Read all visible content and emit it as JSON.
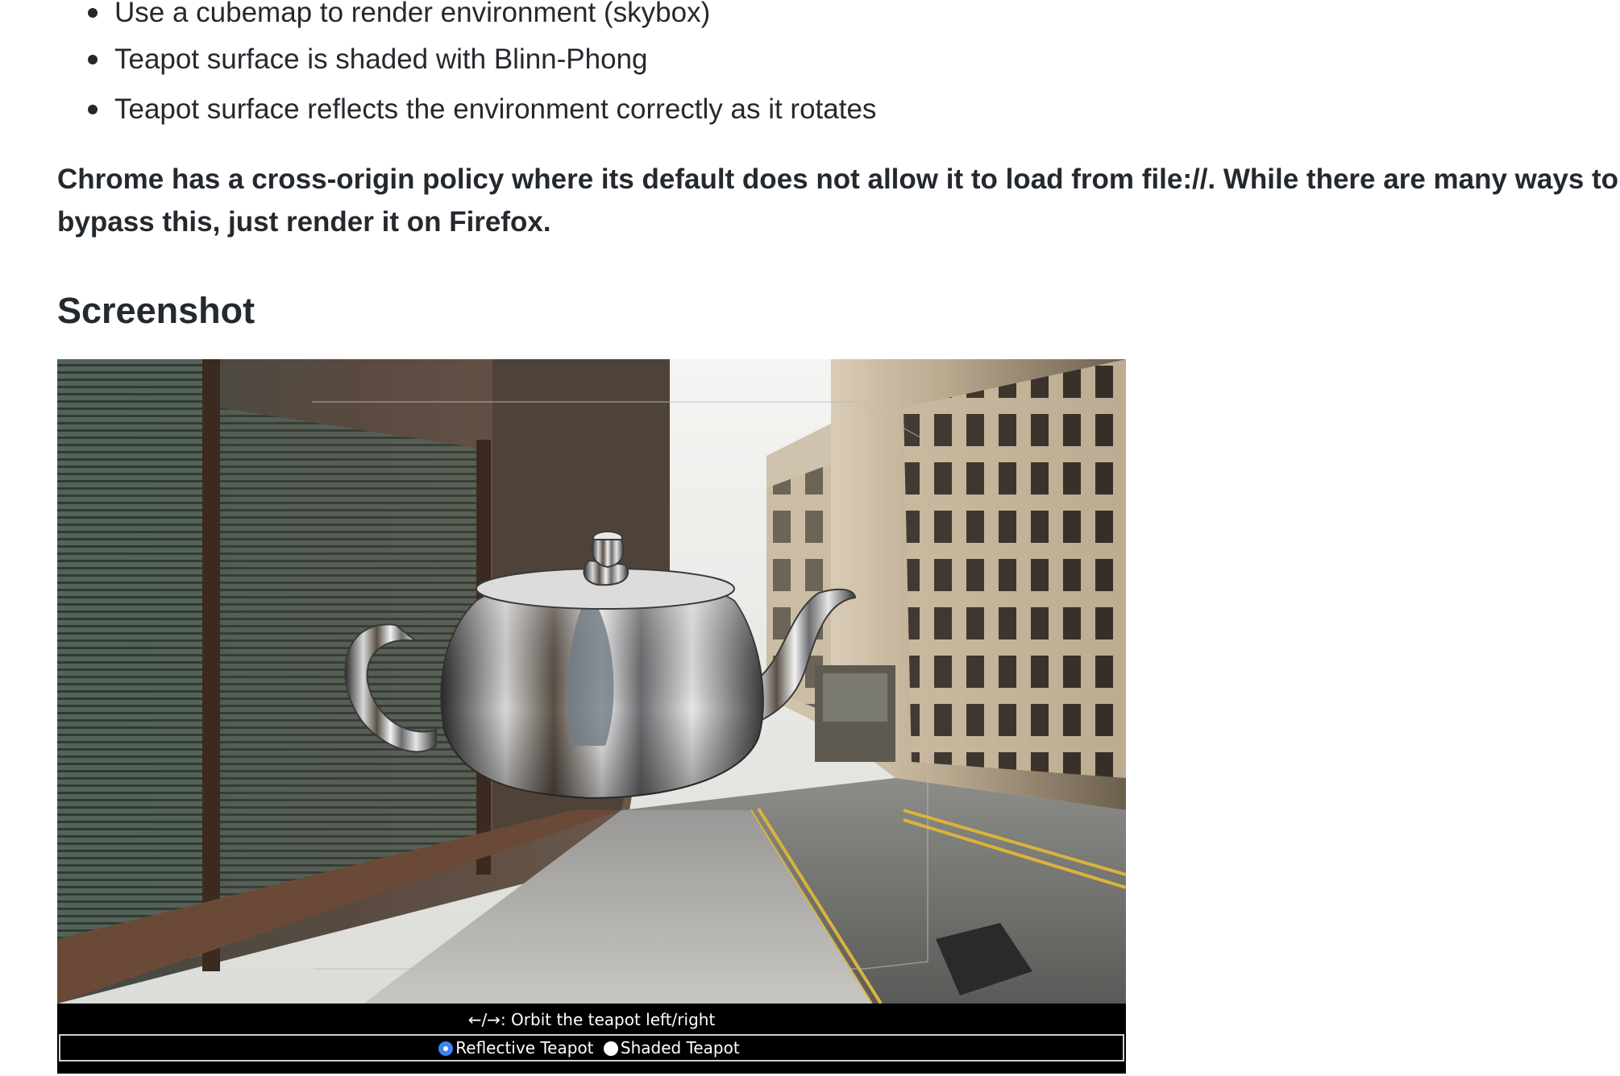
{
  "bullets": [
    "Use a cubemap to render environment (skybox)",
    "Teapot surface is shaded with Blinn-Phong",
    "Teapot surface reflects the environment correctly as it rotates"
  ],
  "note": "Chrome has a cross-origin policy where its default does not allow it to load from file://. While there are many ways to bypass this, just render it on Firefox.",
  "heading": "Screenshot",
  "demo": {
    "instructions": "←/→: Orbit the teapot left/right",
    "modes": [
      {
        "label": "Reflective Teapot",
        "selected": true
      },
      {
        "label": "Shaded Teapot",
        "selected": false
      }
    ]
  }
}
